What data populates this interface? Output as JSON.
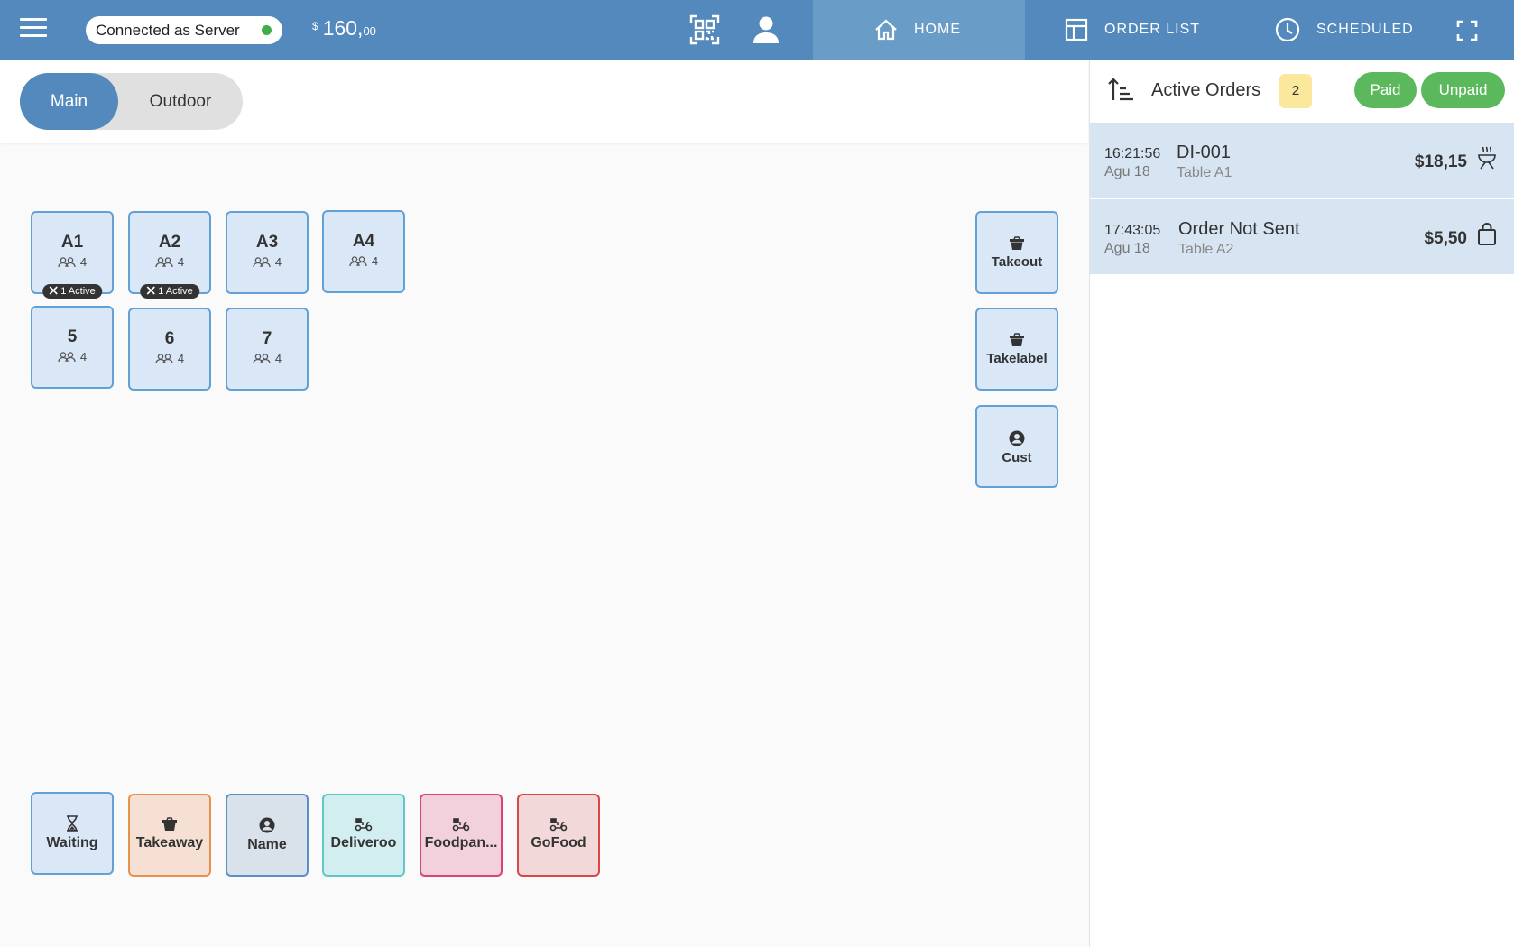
{
  "topbar": {
    "connection_status": "Connected as Server",
    "status_color": "#3fae4a",
    "balance_currency": "$",
    "balance_main": "160,",
    "balance_cents": "00",
    "nav": {
      "home": "HOME",
      "order_list": "ORDER LIST",
      "scheduled": "SCHEDULED"
    }
  },
  "floors": {
    "main": "Main",
    "outdoor": "Outdoor",
    "active": "Main"
  },
  "tables": [
    {
      "name": "A1",
      "seats": "4",
      "badge": "1 Active"
    },
    {
      "name": "A2",
      "seats": "4",
      "badge": "1 Active"
    },
    {
      "name": "A3",
      "seats": "4"
    },
    {
      "name": "A4",
      "seats": "4"
    },
    {
      "name": "5",
      "seats": "4"
    },
    {
      "name": "6",
      "seats": "4"
    },
    {
      "name": "7",
      "seats": "4"
    }
  ],
  "side_tiles": [
    {
      "label": "Takeout",
      "icon": "takeaway-box-icon"
    },
    {
      "label": "Takelabel",
      "icon": "takeaway-box-icon"
    },
    {
      "label": "Cust",
      "icon": "customer-icon"
    }
  ],
  "order_types": [
    {
      "label": "Waiting",
      "icon": "hourglass-icon",
      "color": "#62a0d6",
      "bg": "#d9e7f6"
    },
    {
      "label": "Takeaway",
      "icon": "takeaway-box-icon",
      "color": "#e8914f",
      "bg": "#f6e0d3"
    },
    {
      "label": "Name",
      "icon": "customer-icon",
      "color": "#5b8fc6",
      "bg": "#d9e1ea"
    },
    {
      "label": "Deliveroo",
      "icon": "scooter-icon",
      "color": "#5fc7c7",
      "bg": "#d3eef0"
    },
    {
      "label": "Foodpan...",
      "icon": "scooter-icon",
      "color": "#d8437a",
      "bg": "#f2d1dc"
    },
    {
      "label": "GoFood",
      "icon": "scooter-icon",
      "color": "#d84848",
      "bg": "#f2d8d8"
    }
  ],
  "active_orders": {
    "title": "Active Orders",
    "count": "2",
    "filters": {
      "paid": "Paid",
      "unpaid": "Unpaid"
    },
    "orders": [
      {
        "time": "16:21:56",
        "date": "Agu 18",
        "name": "DI-001",
        "table": "Table A1",
        "amount": "$18,15",
        "icon": "dine-in-icon"
      },
      {
        "time": "17:43:05",
        "date": "Agu 18",
        "name": "Order Not Sent",
        "table": "Table A2",
        "amount": "$5,50",
        "icon": "shopping-bag-icon"
      }
    ]
  }
}
